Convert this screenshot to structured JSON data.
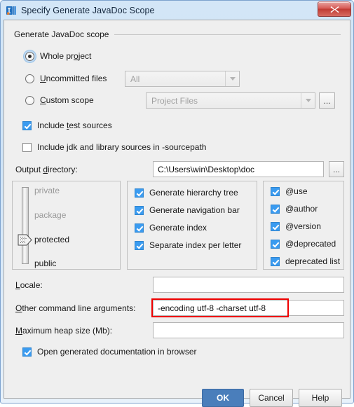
{
  "window": {
    "title": "Specify Generate JavaDoc Scope",
    "icon": "intellij-idea-icon",
    "close_label": "✕"
  },
  "group": {
    "title": "Generate JavaDoc scope"
  },
  "scope": {
    "options": [
      {
        "label": "Whole project",
        "mnemonic": "j",
        "selected": true
      },
      {
        "label": "Uncommitted files",
        "mnemonic": "U",
        "selected": false
      },
      {
        "label": "Custom scope",
        "mnemonic": "C",
        "selected": false
      }
    ],
    "uncommitted_combo": {
      "value": "All",
      "enabled": false
    },
    "custom_combo": {
      "value": "Project Files",
      "enabled": false
    },
    "custom_browse_label": "..."
  },
  "sources": {
    "include_test_sources": {
      "label": "Include test sources",
      "checked": true
    },
    "include_jdk_library": {
      "label": "Include jdk and library sources in -sourcepath",
      "checked": false
    }
  },
  "output": {
    "label": "Output directory:",
    "value": "C:\\Users\\win\\Desktop\\doc",
    "browse_label": "..."
  },
  "visibility": {
    "levels": [
      "private",
      "package",
      "protected",
      "public"
    ],
    "selected": "protected"
  },
  "generate_options": [
    {
      "label": "Generate hierarchy tree",
      "checked": true
    },
    {
      "label": "Generate navigation bar",
      "checked": true
    },
    {
      "label": "Generate index",
      "checked": true
    },
    {
      "label": "Separate index per letter",
      "checked": true
    }
  ],
  "tag_options": [
    {
      "label": "@use",
      "checked": true
    },
    {
      "label": "@author",
      "checked": true
    },
    {
      "label": "@version",
      "checked": true
    },
    {
      "label": "@deprecated",
      "checked": true
    },
    {
      "label": "deprecated list",
      "checked": true
    }
  ],
  "fields": {
    "locale": {
      "label": "Locale:",
      "mnemonic": "L",
      "value": ""
    },
    "other_args": {
      "label": "Other command line arguments:",
      "mnemonic": "O",
      "value": "-encoding utf-8 -charset utf-8"
    },
    "max_heap": {
      "label": "Maximum heap size (Mb):",
      "mnemonic": "M",
      "value": ""
    }
  },
  "open_in_browser": {
    "label": "Open generated documentation in browser",
    "checked": true
  },
  "buttons": {
    "ok": "OK",
    "cancel": "Cancel",
    "help": "Help"
  },
  "colors": {
    "accent": "#4a7ebb",
    "checkbox": "#3a9bf0",
    "annotation": "#ee0000"
  }
}
